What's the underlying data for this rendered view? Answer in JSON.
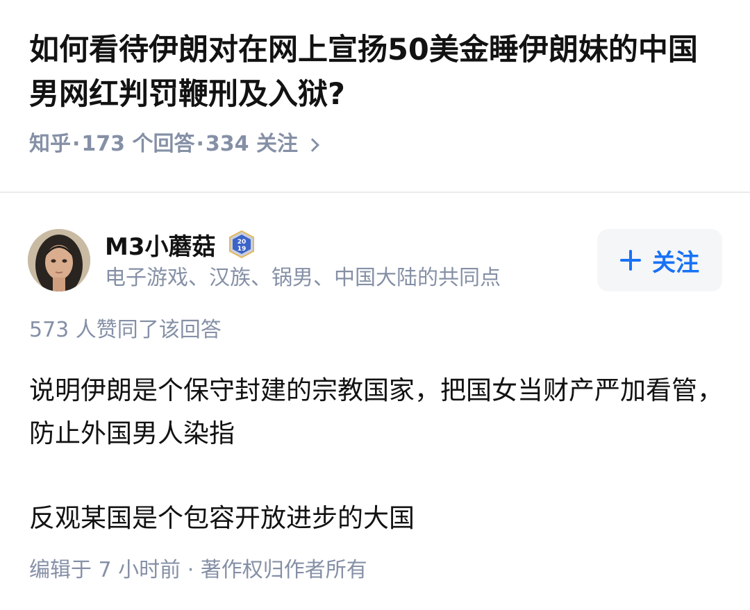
{
  "question": {
    "title": "如何看待伊朗对在网上宣扬50美金睡伊朗妹的中国男网红判罚鞭刑及入狱?",
    "source": "知乎",
    "answers": "173 个回答",
    "followers": "334 关注"
  },
  "author": {
    "name": "M3小蘑菇",
    "headline": "电子游戏、汉族、锅男、中国大陆的共同点",
    "badge_year": "2019",
    "follow_label": "关注"
  },
  "answer": {
    "voteup": "573 人赞同了该回答",
    "paragraphs": [
      "说明伊朗是个保守封建的宗教国家，把国女当财产严加看管，防止外国男人染指",
      "反观某国是个包容开放进步的大国"
    ],
    "edited": "编辑于 7 小时前",
    "copyright": "著作权归作者所有"
  },
  "colors": {
    "accent": "#1772f6",
    "muted": "#8590a6",
    "text": "#121212",
    "button_bg": "#f5f6f7"
  }
}
